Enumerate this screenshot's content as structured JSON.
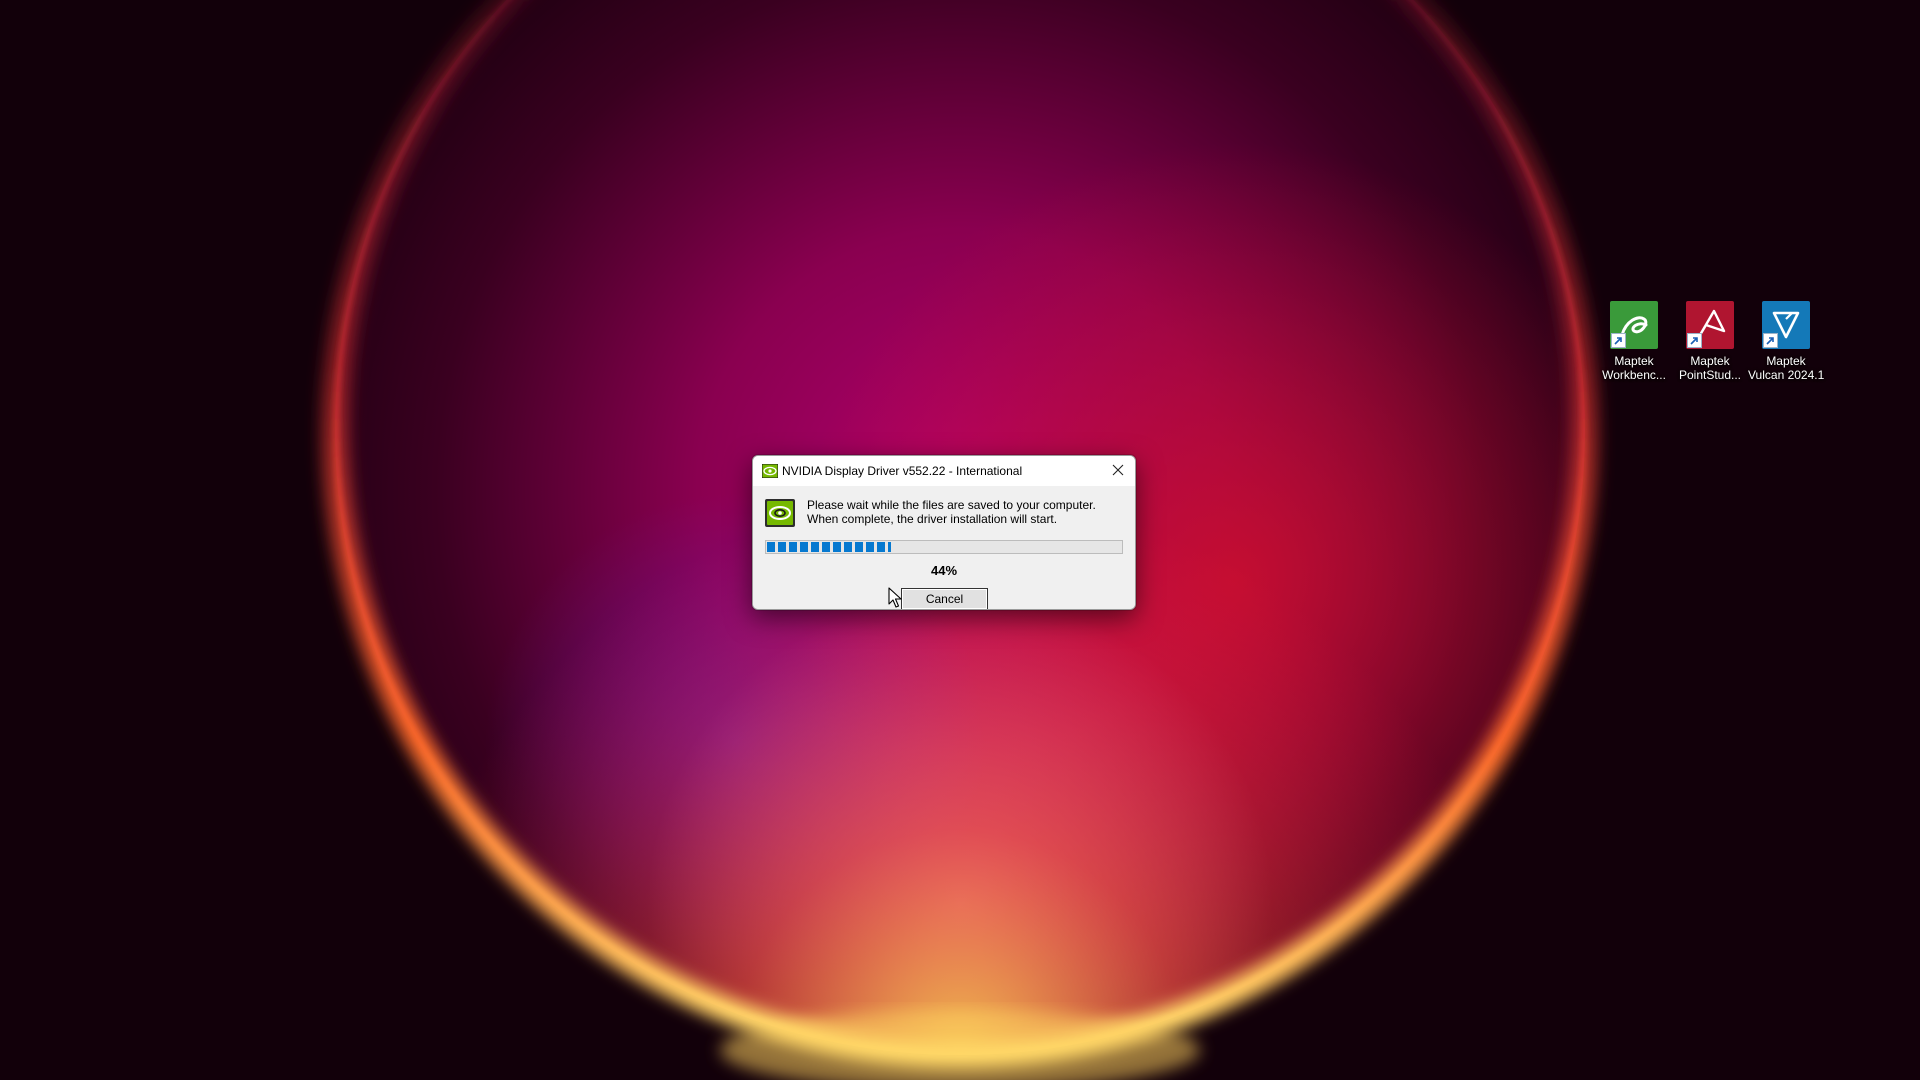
{
  "desktop": {
    "icons": [
      {
        "name": "Maptek Workbench",
        "line1": "Maptek",
        "line2": "Workbenc...",
        "color": "#3a9a3a"
      },
      {
        "name": "Maptek PointStudio",
        "line1": "Maptek",
        "line2": "PointStud...",
        "color": "#b01530"
      },
      {
        "name": "Maptek Vulcan 2024.1",
        "line1": "Maptek",
        "line2": "Vulcan 2024.1",
        "color": "#1479b8"
      }
    ]
  },
  "dialog": {
    "title": "NVIDIA Display Driver v552.22 - International",
    "message_line1": "Please wait while the files are saved to your computer.",
    "message_line2": "When complete, the driver installation will start.",
    "progress_percent_text": "44%",
    "progress_fraction": 0.35,
    "cancel_label": "Cancel",
    "accent_color": "#0679d0",
    "nvidia_green": "#76b900"
  }
}
